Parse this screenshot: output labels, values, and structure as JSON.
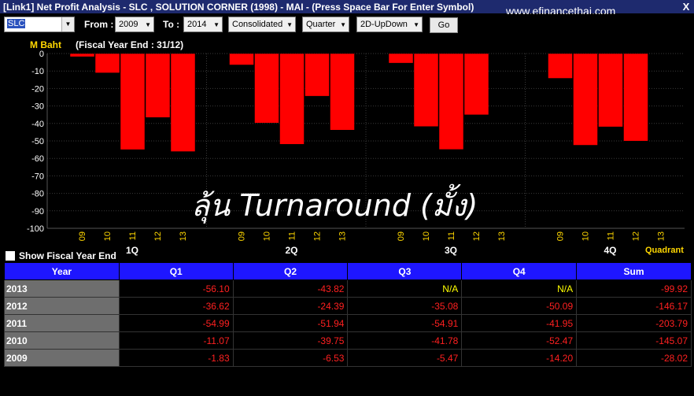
{
  "window": {
    "title": "[Link1] Net Profit Analysis - SLC , SOLUTION CORNER (1998) - MAI - (Press Space Bar For Enter Symbol)",
    "watermark": "www.efinancethai.com",
    "close_label": "X"
  },
  "toolbar": {
    "symbol": "SLC",
    "from_label": "From :",
    "from_value": "2009",
    "to_label": "To :",
    "to_value": "2014",
    "statement": "Consolidated",
    "period": "Quarter",
    "view": "2D-UpDown",
    "go_label": "Go"
  },
  "chart_data": {
    "type": "bar",
    "unit_label": "M Baht",
    "fiscal_note": "(Fiscal Year End : 31/12)",
    "ylim": [
      -100,
      0
    ],
    "yticks": [
      "0",
      "-10",
      "-20",
      "-30",
      "-40",
      "-50",
      "-60",
      "-70",
      "-80",
      "-90",
      "-100"
    ],
    "groups": [
      "1Q",
      "2Q",
      "3Q",
      "4Q"
    ],
    "categories": [
      "09",
      "10",
      "11",
      "12",
      "13"
    ],
    "series": [
      {
        "name": "1Q",
        "values": [
          -1.83,
          -11.07,
          -54.99,
          -36.62,
          -56.1
        ]
      },
      {
        "name": "2Q",
        "values": [
          -6.53,
          -39.75,
          -51.94,
          -24.39,
          -43.82
        ]
      },
      {
        "name": "3Q",
        "values": [
          -5.47,
          -41.78,
          -54.91,
          -35.08,
          null
        ]
      },
      {
        "name": "4Q",
        "values": [
          -14.2,
          -52.47,
          -41.95,
          -50.09,
          null
        ]
      }
    ],
    "bar_color": "#ff0000",
    "grid": true
  },
  "annotation": "ลุ้น Turnaround (มั้ง)",
  "show_fy_label": "Show Fiscal Year End",
  "quadrant_label": "Quadrant",
  "table": {
    "headers": [
      "Year",
      "Q1",
      "Q2",
      "Q3",
      "Q4",
      "Sum"
    ],
    "rows": [
      [
        "2013",
        "-56.10",
        "-43.82",
        "N/A",
        "N/A",
        "-99.92"
      ],
      [
        "2012",
        "-36.62",
        "-24.39",
        "-35.08",
        "-50.09",
        "-146.17"
      ],
      [
        "2011",
        "-54.99",
        "-51.94",
        "-54.91",
        "-41.95",
        "-203.79"
      ],
      [
        "2010",
        "-11.07",
        "-39.75",
        "-41.78",
        "-52.47",
        "-145.07"
      ],
      [
        "2009",
        "-1.83",
        "-6.53",
        "-5.47",
        "-14.20",
        "-28.02"
      ]
    ]
  }
}
